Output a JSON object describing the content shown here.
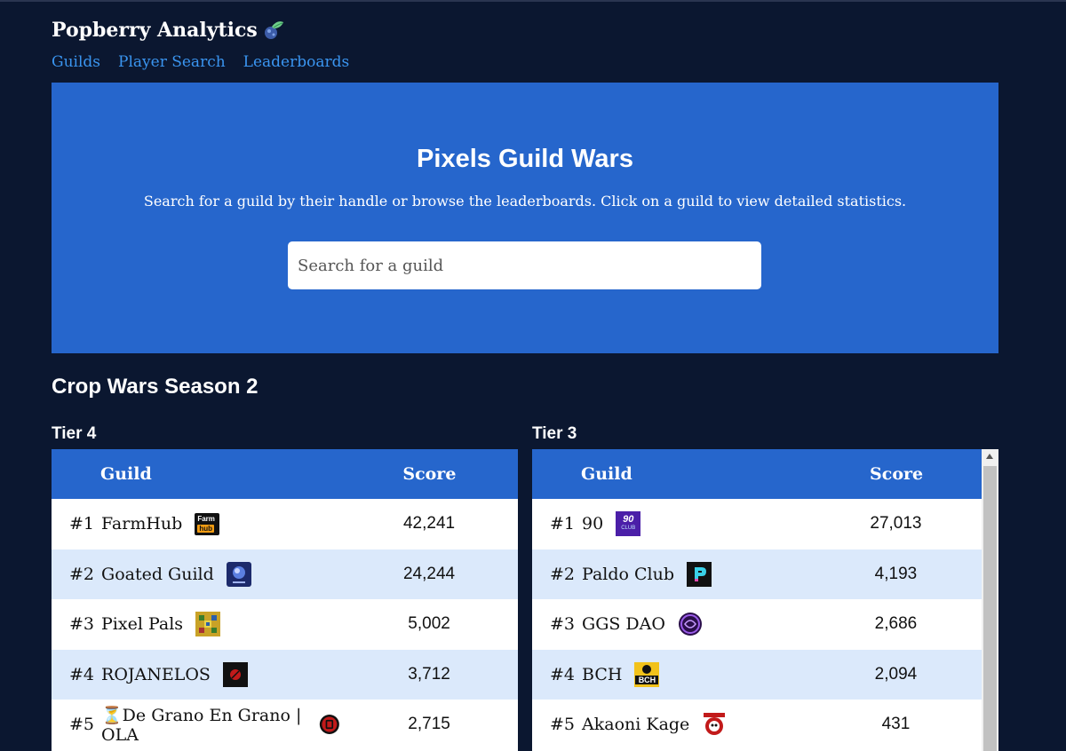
{
  "brand": {
    "title": "Popberry Analytics",
    "icon": "popberry-icon"
  },
  "nav": [
    {
      "label": "Guilds"
    },
    {
      "label": "Player Search"
    },
    {
      "label": "Leaderboards"
    }
  ],
  "hero": {
    "title": "Pixels Guild Wars",
    "subtitle": "Search for a guild by their handle or browse the leaderboards. Click on a guild to view detailed statistics.",
    "search_placeholder": "Search for a guild"
  },
  "section": {
    "title": "Crop Wars Season 2"
  },
  "tiers": [
    {
      "title": "Tier 4",
      "headers": {
        "guild": "Guild",
        "score": "Score"
      },
      "rows": [
        {
          "rank": "#1",
          "name": "FarmHub",
          "score": "42,241",
          "logo": "farmhub-logo",
          "logo_text": "Farm hub"
        },
        {
          "rank": "#2",
          "name": "Goated Guild",
          "score": "24,244",
          "logo": "goated-guild-logo"
        },
        {
          "rank": "#3",
          "name": "Pixel Pals",
          "score": "5,002",
          "logo": "pixel-pals-logo"
        },
        {
          "rank": "#4",
          "name": "ROJANELOS",
          "score": "3,712",
          "logo": "rojanelos-logo"
        },
        {
          "rank": "#5",
          "name": "⏳De Grano En Grano | OLA",
          "score": "2,715",
          "logo": "de-grano-logo"
        }
      ]
    },
    {
      "title": "Tier 3",
      "headers": {
        "guild": "Guild",
        "score": "Score"
      },
      "rows": [
        {
          "rank": "#1",
          "name": "90",
          "score": "27,013",
          "logo": "ninety-club-logo",
          "logo_text": "90 CLUB"
        },
        {
          "rank": "#2",
          "name": "Paldo Club",
          "score": "4,193",
          "logo": "paldo-club-logo"
        },
        {
          "rank": "#3",
          "name": "GGS DAO",
          "score": "2,686",
          "logo": "ggs-dao-logo"
        },
        {
          "rank": "#4",
          "name": "BCH",
          "score": "2,094",
          "logo": "bch-logo",
          "logo_text": "BCH"
        },
        {
          "rank": "#5",
          "name": "Akaoni Kage",
          "score": "431",
          "logo": "akaoni-kage-logo"
        }
      ]
    }
  ],
  "colors": {
    "background": "#0b1730",
    "hero": "#2666cc",
    "link": "#3a95f0",
    "row_alt": "#dbe9fb"
  }
}
